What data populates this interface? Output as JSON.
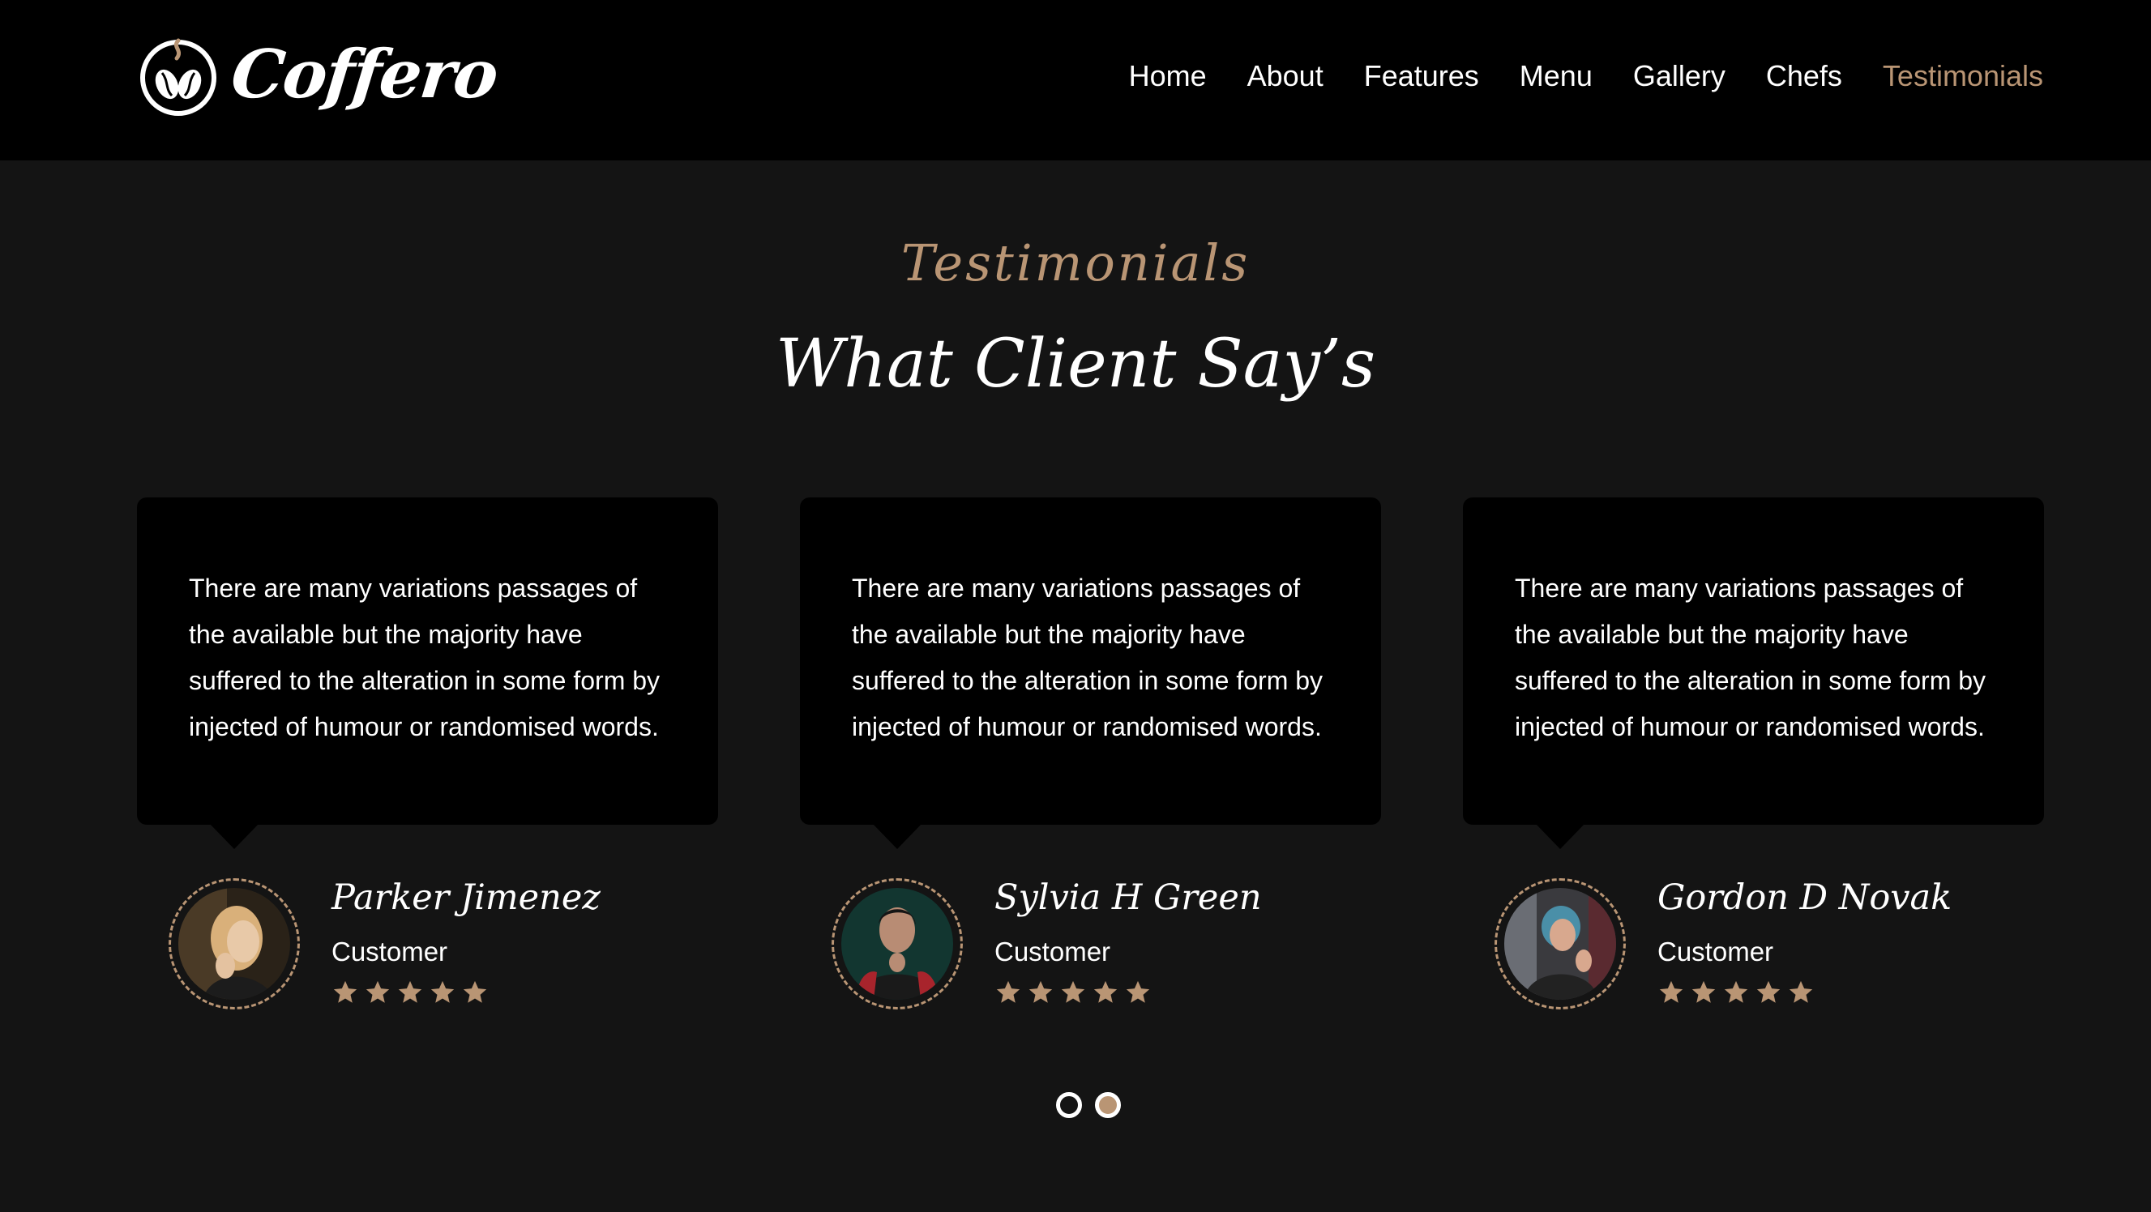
{
  "brand": {
    "name": "Coffero",
    "accent_color": "#b99574",
    "logo_icon": "coffee-beans-cup-icon"
  },
  "nav": {
    "items": [
      {
        "label": "Home",
        "active": false
      },
      {
        "label": "About",
        "active": false
      },
      {
        "label": "Features",
        "active": false
      },
      {
        "label": "Menu",
        "active": false
      },
      {
        "label": "Gallery",
        "active": false
      },
      {
        "label": "Chefs",
        "active": false
      },
      {
        "label": "Testimonials",
        "active": true
      }
    ]
  },
  "section": {
    "eyebrow": "Testimonials",
    "heading": "What Client Say’s"
  },
  "testimonials": [
    {
      "quote": "There are many variations passages of the available but the majority have suffered to the alteration in some form by injected of humour or randomised words.",
      "name": "Parker Jimenez",
      "role": "Customer",
      "rating": 5
    },
    {
      "quote": "There are many variations passages of the available but the majority have suffered to the alteration in some form by injected of humour or randomised words.",
      "name": "Sylvia H Green",
      "role": "Customer",
      "rating": 5
    },
    {
      "quote": "There are many variations passages of the available but the majority have suffered to the alteration in some form by injected of humour or randomised words.",
      "name": "Gordon D Novak",
      "role": "Customer",
      "rating": 5
    }
  ],
  "pagination": {
    "pages": 2,
    "active_page": 2
  }
}
